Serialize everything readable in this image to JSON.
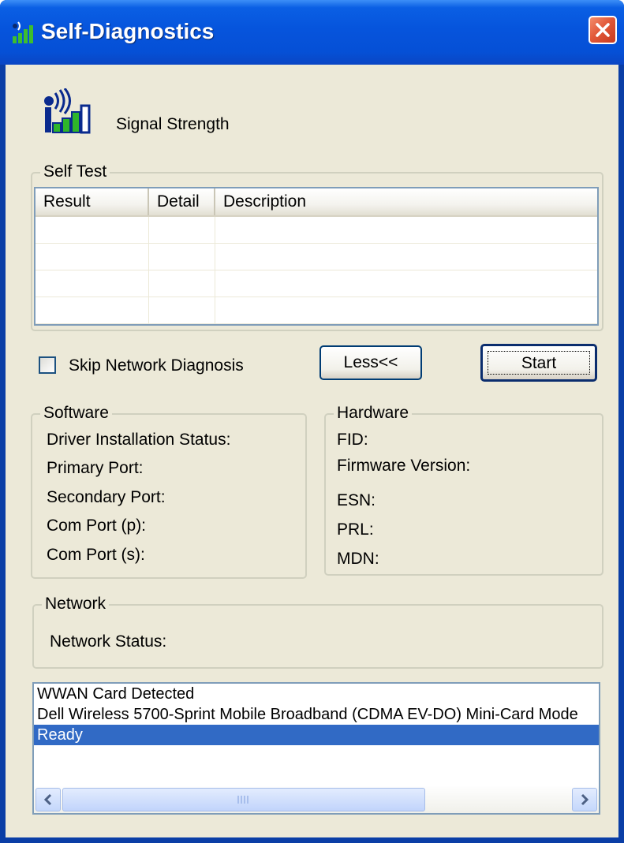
{
  "window": {
    "title": "Self-Diagnostics",
    "title_icon": "signal-bars-icon",
    "close_icon": "close-icon"
  },
  "header": {
    "icon": "signal-strength-icon",
    "signal_label": "Signal Strength"
  },
  "self_test": {
    "group_label": "Self Test",
    "columns": [
      "Result",
      "Detail",
      "Description"
    ],
    "rows": [
      [
        "",
        "",
        ""
      ],
      [
        "",
        "",
        ""
      ],
      [
        "",
        "",
        ""
      ],
      [
        "",
        "",
        ""
      ]
    ]
  },
  "controls": {
    "skip_network_label": "Skip Network Diagnosis",
    "skip_network_checked": false,
    "less_button": "Less<<",
    "start_button": "Start"
  },
  "software": {
    "group_label": "Software",
    "fields": [
      "Driver Installation Status:",
      "Primary Port:",
      "Secondary Port:",
      "Com Port (p):",
      "Com Port (s):"
    ]
  },
  "hardware": {
    "group_label": "Hardware",
    "fields": [
      "FID:",
      "Firmware Version:",
      "ESN:",
      "PRL:",
      "MDN:"
    ]
  },
  "network": {
    "group_label": "Network",
    "status_label": "Network Status:"
  },
  "log": {
    "lines": [
      "WWAN Card Detected",
      "Dell Wireless 5700-Sprint Mobile Broadband (CDMA EV-DO) Mini-Card Mode",
      "Ready"
    ],
    "selected_index": 2
  },
  "colors": {
    "titlebar": "#0654dc",
    "dialog_bg": "#ece9d8",
    "selection": "#316ac5",
    "close_button": "#e2593a"
  }
}
